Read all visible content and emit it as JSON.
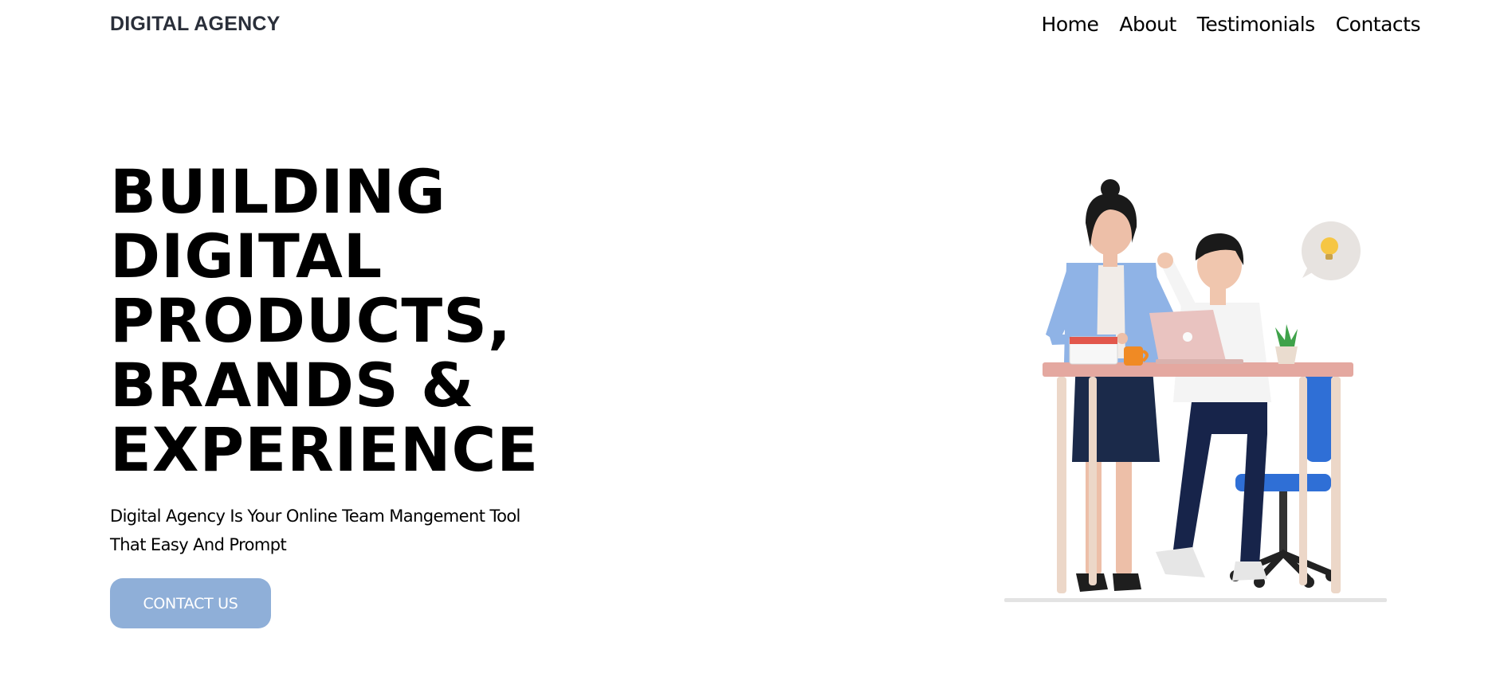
{
  "header": {
    "logo": "DIGITAL AGENCY",
    "nav": [
      "Home",
      "About",
      "Testimonials",
      "Contacts"
    ]
  },
  "hero": {
    "title_lines": [
      "BUILDING",
      "DIGITAL",
      "PRODUCTS,",
      "BRANDS &",
      "EXPERIENCE"
    ],
    "description": "Digital Agency Is Your Online Team Mangement Tool That Easy And Prompt",
    "cta_label": "CONTACT US"
  },
  "colors": {
    "cta_background": "#8fafd8",
    "logo_text": "#2a2f3a",
    "text": "#000000"
  },
  "illustration": {
    "icon": "lightbulb-icon"
  }
}
